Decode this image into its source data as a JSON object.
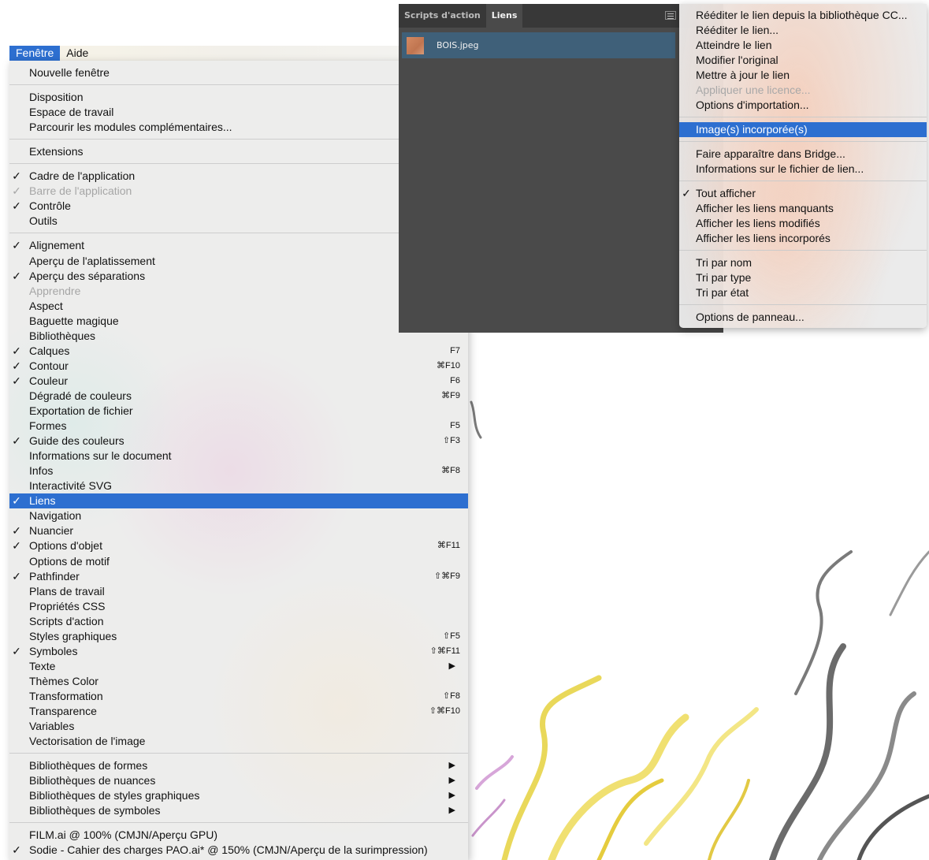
{
  "menubar": {
    "items": [
      {
        "label": "Fenêtre",
        "active": true
      },
      {
        "label": "Aide",
        "active": false
      }
    ]
  },
  "window_menu": {
    "items": [
      {
        "label": "Nouvelle fenêtre"
      },
      {
        "label": "Disposition"
      },
      {
        "label": "Espace de travail"
      },
      {
        "label": "Parcourir les modules complémentaires..."
      },
      {
        "label": "Extensions"
      },
      {
        "label": "Cadre de l'application",
        "checked": true
      },
      {
        "label": "Barre de l'application",
        "checked": true,
        "disabled": true
      },
      {
        "label": "Contrôle",
        "checked": true
      },
      {
        "label": "Outils"
      },
      {
        "label": "Alignement",
        "checked": true
      },
      {
        "label": "Aperçu de l'aplatissement"
      },
      {
        "label": "Aperçu des séparations",
        "checked": true
      },
      {
        "label": "Apprendre",
        "disabled": true
      },
      {
        "label": "Aspect"
      },
      {
        "label": "Baguette magique"
      },
      {
        "label": "Bibliothèques"
      },
      {
        "label": "Calques",
        "checked": true,
        "shortcut": "F7"
      },
      {
        "label": "Contour",
        "checked": true,
        "shortcut": "⌘F10"
      },
      {
        "label": "Couleur",
        "checked": true,
        "shortcut": "F6"
      },
      {
        "label": "Dégradé de couleurs",
        "shortcut": "⌘F9"
      },
      {
        "label": "Exportation de fichier"
      },
      {
        "label": "Formes",
        "shortcut": "F5"
      },
      {
        "label": "Guide des couleurs",
        "checked": true,
        "shortcut": "⇧F3"
      },
      {
        "label": "Informations sur le document"
      },
      {
        "label": "Infos",
        "shortcut": "⌘F8"
      },
      {
        "label": "Interactivité SVG"
      },
      {
        "label": "Liens",
        "checked": true,
        "selected": true
      },
      {
        "label": "Navigation"
      },
      {
        "label": "Nuancier",
        "checked": true
      },
      {
        "label": "Options d'objet",
        "checked": true,
        "shortcut": "⌘F11"
      },
      {
        "label": "Options de motif"
      },
      {
        "label": "Pathfinder",
        "checked": true,
        "shortcut": "⇧⌘F9"
      },
      {
        "label": "Plans de travail"
      },
      {
        "label": "Propriétés CSS"
      },
      {
        "label": "Scripts d'action"
      },
      {
        "label": "Styles graphiques",
        "shortcut": "⇧F5"
      },
      {
        "label": "Symboles",
        "checked": true,
        "shortcut": "⇧⌘F11"
      },
      {
        "label": "Texte",
        "submenu": true
      },
      {
        "label": "Thèmes Color"
      },
      {
        "label": "Transformation",
        "shortcut": "⇧F8"
      },
      {
        "label": "Transparence",
        "shortcut": "⇧⌘F10"
      },
      {
        "label": "Variables"
      },
      {
        "label": "Vectorisation de l'image"
      },
      {
        "label": "Bibliothèques de formes",
        "submenu": true
      },
      {
        "label": "Bibliothèques de nuances",
        "submenu": true
      },
      {
        "label": "Bibliothèques de styles graphiques",
        "submenu": true
      },
      {
        "label": "Bibliothèques de symboles",
        "submenu": true
      },
      {
        "label": "FILM.ai @ 100% (CMJN/Aperçu GPU)"
      },
      {
        "label": "Sodie - Cahier des charges PAO.ai* @ 150% (CMJN/Aperçu de la surimpression)",
        "checked": true
      }
    ],
    "check_glyph": "✓",
    "submenu_glyph": "▶"
  },
  "links_panel": {
    "tabs": [
      {
        "label": "Scripts d'action",
        "active": false
      },
      {
        "label": "Liens",
        "active": true
      }
    ],
    "files": [
      {
        "name": "BOIS.jpeg"
      }
    ]
  },
  "links_menu": {
    "items": [
      {
        "label": "Rééditer le lien depuis la bibliothèque CC..."
      },
      {
        "label": "Rééditer le lien..."
      },
      {
        "label": "Atteindre le lien"
      },
      {
        "label": "Modifier l'original"
      },
      {
        "label": "Mettre à jour le lien"
      },
      {
        "label": "Appliquer une licence...",
        "disabled": true
      },
      {
        "label": "Options d'importation..."
      },
      {
        "label": "Image(s) incorporée(s)",
        "selected": true
      },
      {
        "label": "Faire apparaître dans Bridge..."
      },
      {
        "label": "Informations sur le fichier de lien..."
      },
      {
        "label": "Tout afficher",
        "checked": true
      },
      {
        "label": "Afficher les liens manquants"
      },
      {
        "label": "Afficher les liens modifiés"
      },
      {
        "label": "Afficher les liens incorporés"
      },
      {
        "label": "Tri par nom"
      },
      {
        "label": "Tri par type"
      },
      {
        "label": "Tri par état"
      },
      {
        "label": "Options de panneau..."
      }
    ]
  },
  "colors": {
    "highlight": "#2d6fd0",
    "panel_bg": "#4a4a4a",
    "panel_tabbar": "#383838",
    "selected_row": "#3f6079",
    "disabled_text": "#a6a6a6"
  }
}
